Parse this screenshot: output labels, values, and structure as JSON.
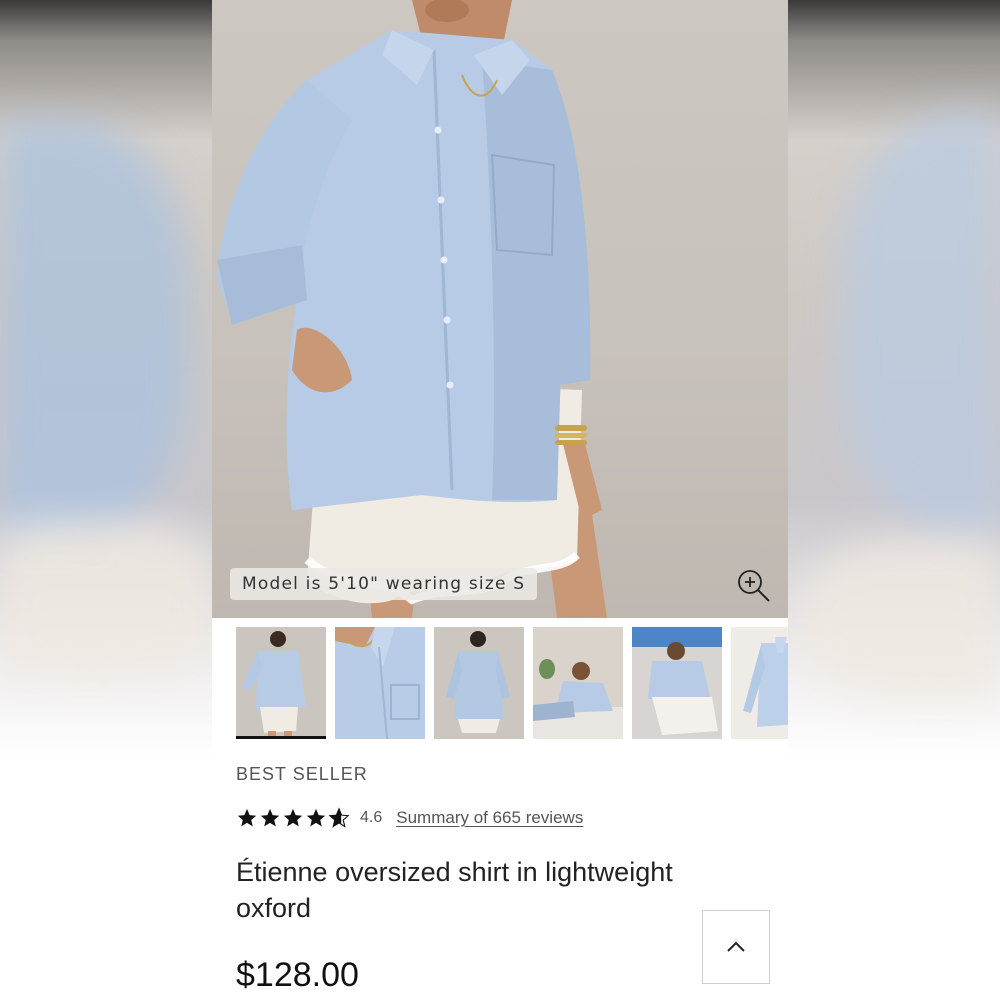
{
  "hero": {
    "model_caption": "Model is 5'10\" wearing size S",
    "zoom_icon": "zoom-in-icon"
  },
  "thumbnails": [
    {
      "scene": "model-front-full",
      "selected": true
    },
    {
      "scene": "collar-detail",
      "selected": false
    },
    {
      "scene": "model-back",
      "selected": false
    },
    {
      "scene": "model-lounging",
      "selected": false
    },
    {
      "scene": "model-seated",
      "selected": false
    },
    {
      "scene": "flat-lay-shirt",
      "selected": false
    }
  ],
  "product": {
    "badge": "BEST SELLER",
    "rating": {
      "value": "4.6",
      "stars_filled": 4.6,
      "stars_total": 5,
      "reviews_link": "Summary of 665 reviews"
    },
    "title": "Étienne oversized shirt in lightweight oxford",
    "price": "$128.00"
  },
  "back_to_top_icon": "chevron-up-icon",
  "colors": {
    "shirt_blue": "#b7cbe6",
    "skirt_ivory": "#f1ece3",
    "text_primary": "#222222",
    "text_secondary": "#555555"
  }
}
